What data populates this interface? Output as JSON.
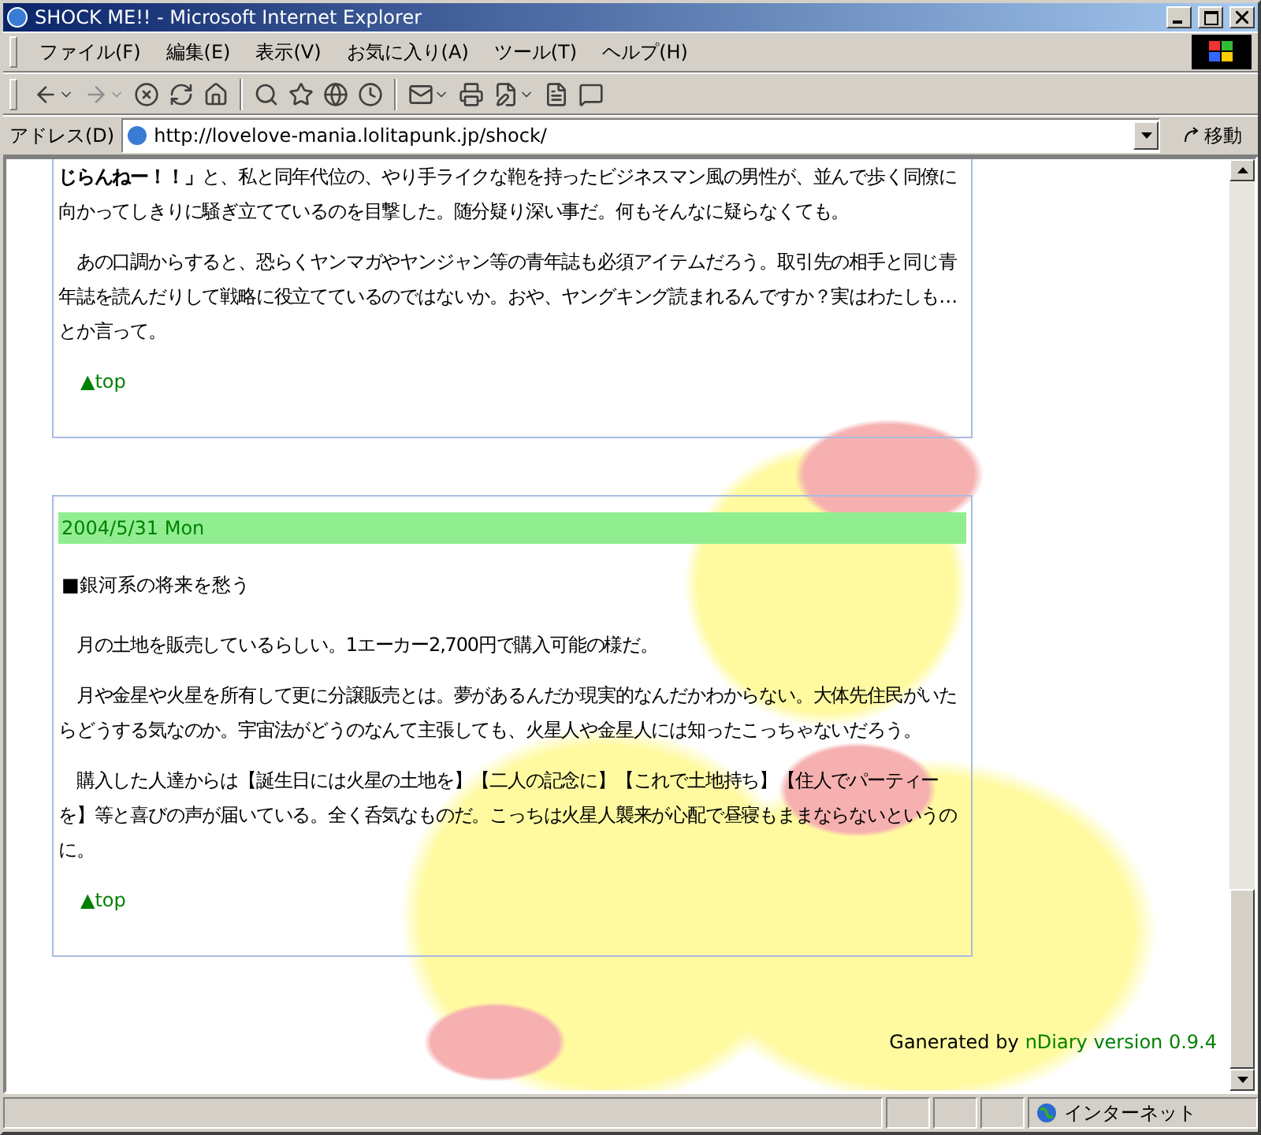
{
  "window": {
    "title": "SHOCK ME!! - Microsoft Internet Explorer"
  },
  "menu": [
    "ファイル(F)",
    "編集(E)",
    "表示(V)",
    "お気に入り(A)",
    "ツール(T)",
    "ヘルプ(H)"
  ],
  "address_bar": {
    "label": "アドレス(D)",
    "url": "http://lovelove-mania.lolitapunk.jp/shock/",
    "go_button": "移動"
  },
  "entries": [
    {
      "paragraphs": [
        "**じらんねー！！」**と、私と同年代位の、やり手ライクな鞄を持ったビジネスマン風の男性が、並んで歩く同僚に向かってしきりに騒ぎ立てているのを目撃した。随分疑り深い事だ。何もそんなに疑らなくても。",
        "　あの口調からすると、恐らくヤンマガやヤンジャン等の青年誌も必須アイテムだろう。取引先の相手と同じ青年誌を読んだりして戦略に役立てているのではないか。おや、ヤングキング読まれるんですか？実はわたしも…とか言って。"
      ],
      "top_link": "▲top"
    },
    {
      "date": "2004/5/31 Mon",
      "title": "■銀河系の将来を愁う",
      "paragraphs": [
        "　月の土地を販売しているらしい。1エーカー2,700円で購入可能の様だ。",
        "　月や金星や火星を所有して更に分譲販売とは。夢があるんだか現実的なんだかわからない。大体先住民がいたらどうする気なのか。宇宙法がどうのなんて主張しても、火星人や金星人には知ったこっちゃないだろう。",
        "　購入した人達からは【誕生日には火星の土地を】【二人の記念に】【これで土地持ち】【住人でパーティーを】等と喜びの声が届いている。全く呑気なものだ。こっちは火星人襲来が心配で昼寝もままならないというのに。"
      ],
      "top_link": "▲top"
    }
  ],
  "footer": {
    "prefix": "Ganerated by",
    "link": "nDiary version 0.9.4"
  },
  "status_bar": {
    "zone": "インターネット"
  }
}
